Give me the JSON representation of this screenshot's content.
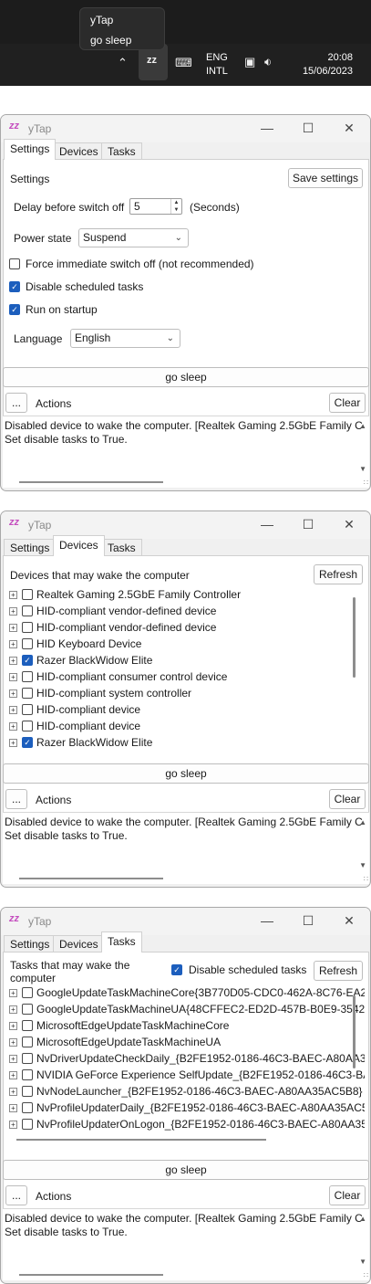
{
  "taskbar": {
    "tray_menu": [
      "yTap",
      "go sleep"
    ],
    "lang_line1": "ENG",
    "lang_line2": "INTL",
    "time": "20:08",
    "date": "15/06/2023",
    "icons": [
      "chevron-up-icon",
      "ytap-zz-icon",
      "keyboard-icon",
      "network-icon",
      "volume-icon"
    ]
  },
  "app": {
    "title": "yTap",
    "tabs": [
      "Settings",
      "Devices",
      "Tasks"
    ],
    "go_sleep_label": "go sleep",
    "more_label": "...",
    "actions_label": "Actions",
    "clear_label": "Clear",
    "log": [
      "Disabled device to wake the computer. [Realtek Gaming 2.5GbE Family C",
      "Set disable tasks to True."
    ]
  },
  "settings": {
    "heading": "Settings",
    "save_label": "Save settings",
    "delay_label": "Delay before switch off",
    "delay_value": "5",
    "delay_unit": "(Seconds)",
    "power_label": "Power state",
    "power_value": "Suspend",
    "force_label": "Force immediate switch off (not recommended)",
    "force_checked": false,
    "disable_tasks_label": "Disable scheduled tasks",
    "disable_tasks_checked": true,
    "startup_label": "Run on startup",
    "startup_checked": true,
    "language_label": "Language",
    "language_value": "English"
  },
  "devices": {
    "heading": "Devices that may wake the computer",
    "refresh_label": "Refresh",
    "items": [
      {
        "name": "Realtek Gaming 2.5GbE Family Controller",
        "checked": false
      },
      {
        "name": "HID-compliant vendor-defined device",
        "checked": false
      },
      {
        "name": "HID-compliant vendor-defined device",
        "checked": false
      },
      {
        "name": "HID Keyboard Device",
        "checked": false
      },
      {
        "name": "Razer BlackWidow Elite",
        "checked": true
      },
      {
        "name": "HID-compliant consumer control device",
        "checked": false
      },
      {
        "name": "HID-compliant system controller",
        "checked": false
      },
      {
        "name": "HID-compliant device",
        "checked": false
      },
      {
        "name": "HID-compliant device",
        "checked": false
      },
      {
        "name": "Razer BlackWidow Elite",
        "checked": true
      }
    ]
  },
  "tasks": {
    "heading_line1": "Tasks that may wake the",
    "heading_line2": "computer",
    "disable_label": "Disable scheduled tasks",
    "disable_checked": true,
    "refresh_label": "Refresh",
    "items": [
      {
        "name": "GoogleUpdateTaskMachineCore{3B770D05-CDC0-462A-8C76-EA2",
        "checked": false
      },
      {
        "name": "GoogleUpdateTaskMachineUA{48CFFEC2-ED2D-457B-B0E9-35424",
        "checked": false
      },
      {
        "name": "MicrosoftEdgeUpdateTaskMachineCore",
        "checked": false
      },
      {
        "name": "MicrosoftEdgeUpdateTaskMachineUA",
        "checked": false
      },
      {
        "name": "NvDriverUpdateCheckDaily_{B2FE1952-0186-46C3-BAEC-A80AA3",
        "checked": false
      },
      {
        "name": "NVIDIA GeForce Experience SelfUpdate_{B2FE1952-0186-46C3-BA",
        "checked": false
      },
      {
        "name": "NvNodeLauncher_{B2FE1952-0186-46C3-BAEC-A80AA35AC5B8}",
        "checked": false
      },
      {
        "name": "NvProfileUpdaterDaily_{B2FE1952-0186-46C3-BAEC-A80AA35AC5",
        "checked": false
      },
      {
        "name": "NvProfileUpdaterOnLogon_{B2FE1952-0186-46C3-BAEC-A80AA35",
        "checked": false
      }
    ]
  }
}
